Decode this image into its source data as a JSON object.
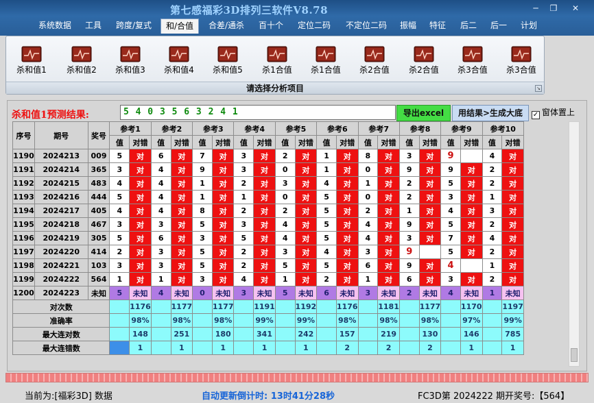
{
  "window": {
    "title": "第七感福彩3D排列三软件V8.78",
    "minimize_icon": "─",
    "restore_icon": "❐",
    "close_icon": "✕"
  },
  "menu": [
    "系统数据",
    "工具",
    "跨度/复式",
    "和/合值",
    "合差/通杀",
    "百十个",
    "定位二码",
    "不定位二码",
    "振幅",
    "特征",
    "后二",
    "后一",
    "计划"
  ],
  "active_menu": "和/合值",
  "ribbon": {
    "tools": [
      "杀和值1",
      "杀和值2",
      "杀和值3",
      "杀和值4",
      "杀和值5",
      "杀1合值",
      "杀1合值",
      "杀2合值",
      "杀2合值",
      "杀3合值",
      "杀3合值"
    ],
    "caption": "请选择分析项目"
  },
  "result": {
    "label": "杀和值1预测结果:",
    "value": "5 4 0 3 5 6 3 2 4 1",
    "export_button": "导出excel",
    "generate_button": "用结果>生成大底",
    "topmost_label": "窗体置上",
    "topmost_checked": true
  },
  "grid": {
    "headers": {
      "seq": "序号",
      "issue": "期号",
      "prize": "奖号",
      "value": "值",
      "check": "对错"
    },
    "refs": [
      "参考1",
      "参考2",
      "参考3",
      "参考4",
      "参考5",
      "参考6",
      "参考7",
      "参考8",
      "参考9",
      "参考10"
    ],
    "hit_text": "对",
    "rows": [
      {
        "seq": "1190",
        "issue": "2024213",
        "prize": "009",
        "cells": [
          [
            "5",
            "对"
          ],
          [
            "6",
            "对"
          ],
          [
            "7",
            "对"
          ],
          [
            "3",
            "对"
          ],
          [
            "2",
            "对"
          ],
          [
            "1",
            "对"
          ],
          [
            "8",
            "对"
          ],
          [
            "3",
            "对"
          ],
          [
            "9",
            ""
          ],
          [
            "4",
            "对"
          ]
        ]
      },
      {
        "seq": "1191",
        "issue": "2024214",
        "prize": "365",
        "cells": [
          [
            "3",
            "对"
          ],
          [
            "4",
            "对"
          ],
          [
            "9",
            "对"
          ],
          [
            "3",
            "对"
          ],
          [
            "0",
            "对"
          ],
          [
            "1",
            "对"
          ],
          [
            "0",
            "对"
          ],
          [
            "9",
            "对"
          ],
          [
            "9",
            "对"
          ],
          [
            "2",
            "对"
          ]
        ]
      },
      {
        "seq": "1192",
        "issue": "2024215",
        "prize": "483",
        "cells": [
          [
            "4",
            "对"
          ],
          [
            "4",
            "对"
          ],
          [
            "1",
            "对"
          ],
          [
            "2",
            "对"
          ],
          [
            "3",
            "对"
          ],
          [
            "4",
            "对"
          ],
          [
            "1",
            "对"
          ],
          [
            "2",
            "对"
          ],
          [
            "5",
            "对"
          ],
          [
            "2",
            "对"
          ]
        ]
      },
      {
        "seq": "1193",
        "issue": "2024216",
        "prize": "444",
        "cells": [
          [
            "5",
            "对"
          ],
          [
            "4",
            "对"
          ],
          [
            "1",
            "对"
          ],
          [
            "1",
            "对"
          ],
          [
            "0",
            "对"
          ],
          [
            "5",
            "对"
          ],
          [
            "0",
            "对"
          ],
          [
            "2",
            "对"
          ],
          [
            "3",
            "对"
          ],
          [
            "1",
            "对"
          ]
        ]
      },
      {
        "seq": "1194",
        "issue": "2024217",
        "prize": "405",
        "cells": [
          [
            "4",
            "对"
          ],
          [
            "4",
            "对"
          ],
          [
            "8",
            "对"
          ],
          [
            "2",
            "对"
          ],
          [
            "2",
            "对"
          ],
          [
            "5",
            "对"
          ],
          [
            "2",
            "对"
          ],
          [
            "1",
            "对"
          ],
          [
            "4",
            "对"
          ],
          [
            "3",
            "对"
          ]
        ]
      },
      {
        "seq": "1195",
        "issue": "2024218",
        "prize": "467",
        "cells": [
          [
            "3",
            "对"
          ],
          [
            "3",
            "对"
          ],
          [
            "5",
            "对"
          ],
          [
            "3",
            "对"
          ],
          [
            "4",
            "对"
          ],
          [
            "5",
            "对"
          ],
          [
            "4",
            "对"
          ],
          [
            "9",
            "对"
          ],
          [
            "5",
            "对"
          ],
          [
            "2",
            "对"
          ]
        ]
      },
      {
        "seq": "1196",
        "issue": "2024219",
        "prize": "305",
        "cells": [
          [
            "5",
            "对"
          ],
          [
            "6",
            "对"
          ],
          [
            "3",
            "对"
          ],
          [
            "5",
            "对"
          ],
          [
            "4",
            "对"
          ],
          [
            "5",
            "对"
          ],
          [
            "4",
            "对"
          ],
          [
            "3",
            "对"
          ],
          [
            "7",
            "对"
          ],
          [
            "4",
            "对"
          ]
        ]
      },
      {
        "seq": "1197",
        "issue": "2024220",
        "prize": "414",
        "cells": [
          [
            "2",
            "对"
          ],
          [
            "3",
            "对"
          ],
          [
            "5",
            "对"
          ],
          [
            "2",
            "对"
          ],
          [
            "3",
            "对"
          ],
          [
            "4",
            "对"
          ],
          [
            "3",
            "对"
          ],
          [
            "9",
            ""
          ],
          [
            "5",
            "对"
          ],
          [
            "2",
            "对"
          ]
        ]
      },
      {
        "seq": "1198",
        "issue": "2024221",
        "prize": "103",
        "cells": [
          [
            "3",
            "对"
          ],
          [
            "3",
            "对"
          ],
          [
            "5",
            "对"
          ],
          [
            "2",
            "对"
          ],
          [
            "5",
            "对"
          ],
          [
            "5",
            "对"
          ],
          [
            "6",
            "对"
          ],
          [
            "9",
            "对"
          ],
          [
            "4",
            ""
          ],
          [
            "1",
            "对"
          ]
        ]
      },
      {
        "seq": "1199",
        "issue": "2024222",
        "prize": "564",
        "cells": [
          [
            "1",
            "对"
          ],
          [
            "1",
            "对"
          ],
          [
            "3",
            "对"
          ],
          [
            "4",
            "对"
          ],
          [
            "1",
            "对"
          ],
          [
            "2",
            "对"
          ],
          [
            "1",
            "对"
          ],
          [
            "6",
            "对"
          ],
          [
            "3",
            "对"
          ],
          [
            "2",
            "对"
          ]
        ]
      }
    ],
    "prediction_row": {
      "seq": "1200",
      "issue": "2024223",
      "prize": "未知",
      "values": [
        "5",
        "4",
        "0",
        "3",
        "5",
        "6",
        "3",
        "2",
        "4",
        "1"
      ],
      "unknown_text": "未知"
    },
    "stats": [
      {
        "label": "对次数",
        "values": [
          "1176",
          "1177",
          "1177",
          "1191",
          "1192",
          "1176",
          "1181",
          "1177",
          "1170",
          "1197"
        ]
      },
      {
        "label": "准确率",
        "values": [
          "98%",
          "98%",
          "98%",
          "99%",
          "99%",
          "98%",
          "98%",
          "98%",
          "97%",
          "99%"
        ]
      },
      {
        "label": "最大连对数",
        "values": [
          "148",
          "251",
          "180",
          "341",
          "242",
          "157",
          "219",
          "130",
          "146",
          "785"
        ]
      },
      {
        "label": "最大连错数",
        "values": [
          "1",
          "1",
          "1",
          "1",
          "1",
          "2",
          "2",
          "2",
          "1",
          "1"
        ]
      }
    ]
  },
  "status": {
    "left": "当前为:[福彩3D] 数据",
    "countdown": "自动更新倒计时: 13时41分28秒",
    "right": "FC3D第 2024222 期开奖号:【564】"
  }
}
